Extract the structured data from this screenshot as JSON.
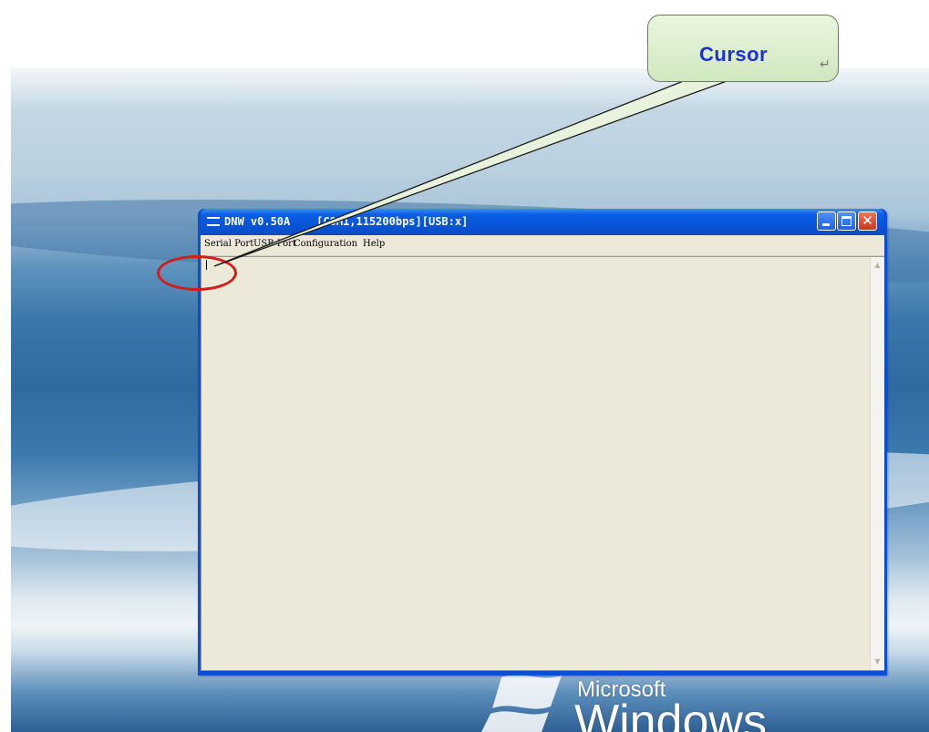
{
  "callout": {
    "text": "Cursor",
    "return_mark": "↵",
    "color": "#1f2fd6"
  },
  "window": {
    "title": "DNW v0.50A    [COM1,115200bps][USB:x]",
    "controls": {
      "minimize_icon": "minimize-icon",
      "maximize_icon": "maximize-icon",
      "close_glyph": "✕"
    }
  },
  "menu": {
    "items": [
      "Serial Port",
      "USB Port",
      "Configuration",
      "Help"
    ]
  },
  "terminal": {
    "content": ""
  },
  "desktop": {
    "logo_microsoft": "Microsoft",
    "logo_windows": "Windows"
  },
  "colors": {
    "titlebar": "#0854d8",
    "highlight_ring": "#d41b1b",
    "client_bg": "#ece9d8"
  }
}
